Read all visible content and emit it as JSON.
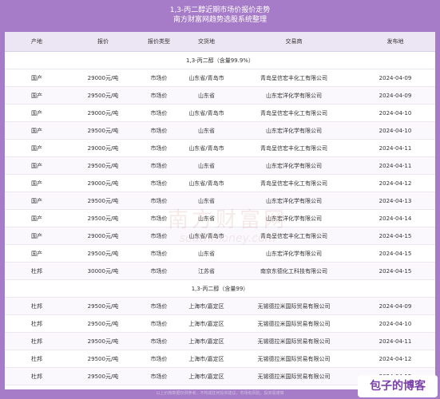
{
  "header": {
    "title_line1": "1,3-丙二醇近期市场价报价走势",
    "title_line2": "南方财富网趋势选股系统整理"
  },
  "table": {
    "columns": [
      "产地",
      "报价",
      "报价类型",
      "交货地",
      "交易商",
      "发布地"
    ],
    "section1": "1,3-丙二醇（含量99.9%）",
    "rows1": [
      [
        "国产",
        "29000元/吨",
        "市场价",
        "山东省/青岛市",
        "青岛呈信宏丰化工有限公司",
        "2024-04-09"
      ],
      [
        "国产",
        "29500元/吨",
        "市场价",
        "山东省",
        "山东宏洋化学有限公司",
        "2024-04-09"
      ],
      [
        "国产",
        "29000元/吨",
        "市场价",
        "山东省/青岛市",
        "青岛呈信宏丰化工有限公司",
        "2024-04-10"
      ],
      [
        "国产",
        "29500元/吨",
        "市场价",
        "山东省",
        "山东宏洋化学有限公司",
        "2024-04-10"
      ],
      [
        "国产",
        "29000元/吨",
        "市场价",
        "山东省/青岛市",
        "青岛呈信宏丰化工有限公司",
        "2024-04-11"
      ],
      [
        "国产",
        "29500元/吨",
        "市场价",
        "山东省",
        "山东宏洋化学有限公司",
        "2024-04-11"
      ],
      [
        "国产",
        "29000元/吨",
        "市场价",
        "山东省/青岛市",
        "青岛呈信宏丰化工有限公司",
        "2024-04-12"
      ],
      [
        "国产",
        "29500元/吨",
        "市场价",
        "山东省",
        "山东宏洋化学有限公司",
        "2024-04-13"
      ],
      [
        "国产",
        "29500元/吨",
        "市场价",
        "山东省",
        "山东宏洋化学有限公司",
        "2024-04-14"
      ],
      [
        "国产",
        "29000元/吨",
        "市场价",
        "山东省/青岛市",
        "青岛呈信宏丰化工有限公司",
        "2024-04-15"
      ],
      [
        "国产",
        "29500元/吨",
        "市场价",
        "山东省",
        "山东宏洋化学有限公司",
        "2024-04-15"
      ],
      [
        "杜邦",
        "30000元/吨",
        "市场价",
        "江苏省",
        "南京东德化工科技有限公司",
        "2024-04-15"
      ]
    ],
    "section2": "1,3-丙二醇（含量99）",
    "rows2": [
      [
        "杜邦",
        "29500元/吨",
        "市场价",
        "上海市/嘉定区",
        "无锡德拉米国际贸易有限公司",
        "2024-04-09"
      ],
      [
        "杜邦",
        "29500元/吨",
        "市场价",
        "上海市/嘉定区",
        "无锡德拉米国际贸易有限公司",
        "2024-04-10"
      ],
      [
        "杜邦",
        "29500元/吨",
        "市场价",
        "上海市/嘉定区",
        "无锡德拉米国际贸易有限公司",
        "2024-04-11"
      ],
      [
        "杜邦",
        "29500元/吨",
        "市场价",
        "上海市/嘉定区",
        "无锡德拉米国际贸易有限公司",
        "2024-04-12"
      ],
      [
        "杜邦",
        "29500元/吨",
        "市场价",
        "上海市/嘉定区",
        "无锡德拉米国际贸易有限公司",
        "2024-04-15"
      ]
    ]
  },
  "watermark": {
    "main": "南方财富网",
    "sub": "southmoney.com"
  },
  "footer": {
    "note": "以上价格数据仅供参考，不构成任何投资建议，市场有风险，投资需谨慎"
  },
  "badge": {
    "text": "包子的博客"
  }
}
